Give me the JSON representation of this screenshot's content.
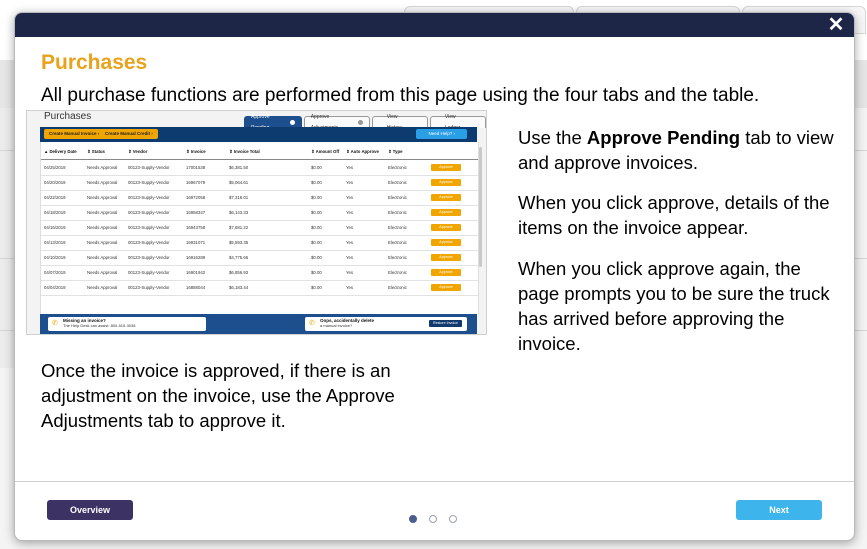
{
  "modal": {
    "close_glyph": "✕",
    "title": "Purchases",
    "intro": "All purchase functions are performed from this page using the four tabs and the table.",
    "right_paragraphs": [
      {
        "pre": "Use the ",
        "bold": "Approve Pending",
        "post": " tab to view and approve invoices."
      },
      {
        "text": "When you click approve, details of the items on the invoice appear."
      },
      {
        "text": "When you click approve again, the page prompts you to be sure the truck has arrived before approving the invoice."
      }
    ],
    "bottom_paragraph": "Once the invoice is approved, if there is an adjustment on the invoice, use the Approve Adjustments tab to approve it.",
    "overview_label": "Overview",
    "next_label": "Next",
    "pagination": {
      "total": 3,
      "current": 1
    }
  },
  "screenshot": {
    "title": "Purchases",
    "tabs": [
      {
        "label": "Approve Pending",
        "active": true,
        "info": true
      },
      {
        "label": "Approve Adjustments",
        "active": false,
        "info": true
      },
      {
        "label": "View History",
        "active": false,
        "info": false
      },
      {
        "label": "View Ledger",
        "active": false,
        "info": false
      }
    ],
    "toolbar_buttons": [
      "Create Manual Invoice",
      "Create Manual Credit"
    ],
    "help_label": "Need Help?",
    "columns": [
      "▲ Delivery Date",
      "⇕ Status",
      "⇕ Vendor",
      "⇕ Invoice",
      "⇕ Invoice Total",
      "⇕ Amount Off",
      "⇕ Auto Approve",
      "⇕ Type"
    ],
    "rows": [
      [
        "04/25/2019",
        "Needs Approval",
        "00123-Supply-Vendor",
        "17001538",
        "$6,381.50",
        "$0.00",
        "Yes",
        "Electronic"
      ],
      [
        "04/20/2019",
        "Needs Approval",
        "00123-Supply-Vendor",
        "16967079",
        "$5,064.61",
        "$0.00",
        "Yes",
        "Electronic"
      ],
      [
        "04/22/2019",
        "Needs Approval",
        "00123-Supply-Vendor",
        "16972058",
        "$7,318.01",
        "$0.00",
        "Yes",
        "Electronic"
      ],
      [
        "04/18/2019",
        "Needs Approval",
        "00123-Supply-Vendor",
        "16958347",
        "$6,143.33",
        "$0.00",
        "Yes",
        "Electronic"
      ],
      [
        "04/16/2019",
        "Needs Approval",
        "00123-Supply-Vendor",
        "16943758",
        "$7,681.22",
        "$0.00",
        "Yes",
        "Electronic"
      ],
      [
        "04/13/2019",
        "Needs Approval",
        "00123-Supply-Vendor",
        "16931071",
        "$5,593.35",
        "$0.00",
        "Yes",
        "Electronic"
      ],
      [
        "04/10/2019",
        "Needs Approval",
        "00123-Supply-Vendor",
        "16916289",
        "$4,775.66",
        "$0.00",
        "Yes",
        "Electronic"
      ],
      [
        "04/07/2019",
        "Needs Approval",
        "00123-Supply-Vendor",
        "16901942",
        "$6,856.93",
        "$0.00",
        "Yes",
        "Electronic"
      ],
      [
        "04/04/2019",
        "Needs Approval",
        "00123-Supply-Vendor",
        "16888044",
        "$6,183.44",
        "$0.00",
        "Yes",
        "Electronic"
      ]
    ],
    "row_action": "Approve",
    "footer": {
      "missing_title": "Missing an invoice?",
      "missing_text": "The Help Desk can assist: 800-515-3038",
      "oops_title": "Oops, accidentally delete",
      "oops_text": "a manual invoice?",
      "restore_label": "Restore Invoice"
    }
  },
  "colors": {
    "header_navy": "#1d2647",
    "title_orange": "#e8a21c",
    "overview_purple": "#3c3364",
    "next_blue": "#3eb4ec"
  }
}
